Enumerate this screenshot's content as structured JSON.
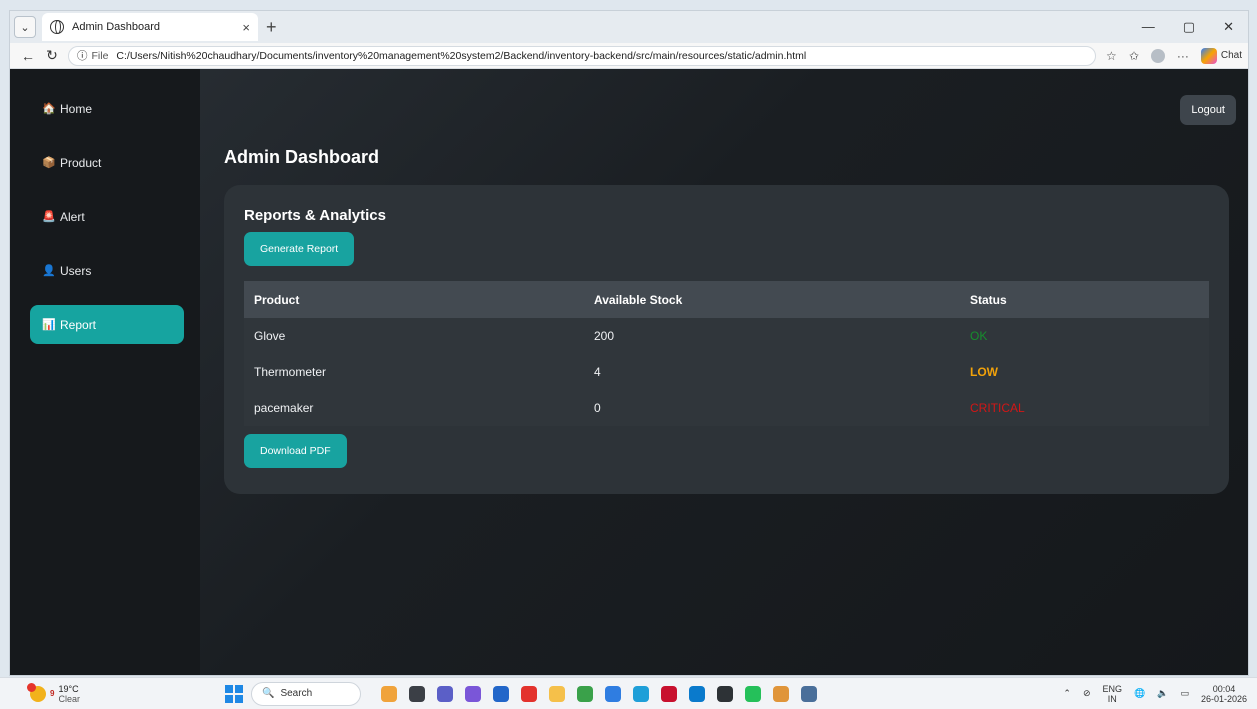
{
  "browser": {
    "tab_title": "Admin Dashboard",
    "tab_close": "×",
    "new_tab": "+",
    "file_label": "File",
    "url": "C:/Users/Nitish%20chaudhary/Documents/inventory%20management%20system2/Backend/inventory-backend/src/main/resources/static/admin.html",
    "chat_label": "Chat",
    "more": "···"
  },
  "sidebar": {
    "items": [
      {
        "label": "Home",
        "icon": "🏠"
      },
      {
        "label": "Product",
        "icon": "📦"
      },
      {
        "label": "Alert",
        "icon": "🚨"
      },
      {
        "label": "Users",
        "icon": "👤"
      },
      {
        "label": "Report",
        "icon": "📊"
      }
    ]
  },
  "header": {
    "logout": "Logout",
    "title": "Admin Dashboard"
  },
  "report": {
    "title": "Reports & Analytics",
    "generate": "Generate Report",
    "download": "Download PDF",
    "columns": [
      "Product",
      "Available Stock",
      "Status"
    ],
    "rows": [
      {
        "product": "Glove",
        "stock": "200",
        "status": "OK"
      },
      {
        "product": "Thermometer",
        "stock": "4",
        "status": "LOW"
      },
      {
        "product": "pacemaker",
        "stock": "0",
        "status": "CRITICAL"
      }
    ]
  },
  "colors": {
    "accent": "#16a4a0",
    "ok": "#168f2d",
    "low": "#f2a20a",
    "critical": "#d31616"
  },
  "taskbar": {
    "weather_temp": "19°C",
    "weather_desc": "Clear",
    "weather_badge": "9",
    "search_placeholder": "Search",
    "lang_top": "ENG",
    "lang_bottom": "IN",
    "time": "00:04",
    "date": "26-01-2026"
  }
}
